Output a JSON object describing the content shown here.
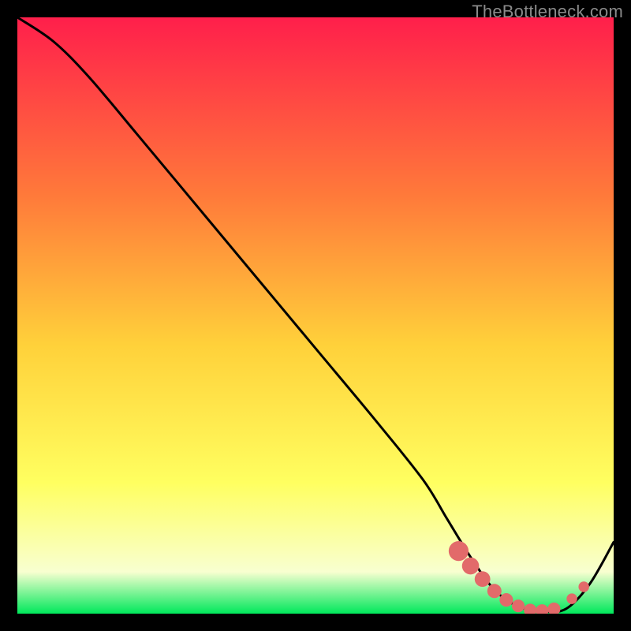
{
  "watermark": "TheBottleneck.com",
  "colors": {
    "bg": "#000000",
    "grad_top": "#ff1f4b",
    "grad_mid1": "#ff7a3a",
    "grad_mid2": "#ffd13a",
    "grad_mid3": "#ffff60",
    "grad_low": "#f8ffd0",
    "grad_bottom": "#00e85b",
    "curve": "#000000",
    "marker": "#e26a6a"
  },
  "chart_data": {
    "type": "line",
    "title": "",
    "xlabel": "",
    "ylabel": "",
    "xlim": [
      0,
      100
    ],
    "ylim": [
      0,
      100
    ],
    "series": [
      {
        "name": "curve",
        "x": [
          0,
          6,
          12,
          20,
          30,
          40,
          50,
          60,
          68,
          72,
          76,
          80,
          84,
          88,
          92,
          96,
          100
        ],
        "y": [
          100,
          96,
          90,
          80.5,
          68.5,
          56.5,
          44.5,
          32.5,
          22.5,
          16,
          9.5,
          4,
          1.2,
          0.4,
          0.8,
          5,
          12
        ]
      }
    ],
    "markers": [
      {
        "name": "flat-region-dots",
        "x": [
          74,
          76,
          78,
          80,
          82,
          84,
          86,
          88,
          90,
          93,
          95
        ],
        "y": [
          10.5,
          8.0,
          5.8,
          3.8,
          2.3,
          1.3,
          0.6,
          0.5,
          0.8,
          2.5,
          4.5
        ],
        "color": "#e26a6a",
        "radius_scale": [
          1.4,
          1.2,
          1.1,
          1.0,
          0.95,
          0.9,
          0.9,
          0.9,
          0.9,
          0.75,
          0.75
        ]
      }
    ]
  }
}
